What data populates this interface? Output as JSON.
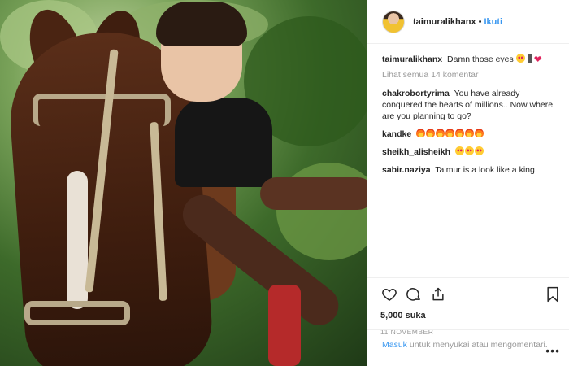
{
  "post": {
    "username": "taimuralikhanx",
    "separator": "•",
    "follow_label": "Ikuti"
  },
  "caption": {
    "username": "taimuralikhanx",
    "text": "Damn those eyes"
  },
  "view_all_comments": "Lihat semua 14 komentar",
  "comments": [
    {
      "username": "chakrobortyrima",
      "text": "You have already conquered the hearts of millions.. Now where are you planning to go?"
    },
    {
      "username": "kandke",
      "text": ""
    },
    {
      "username": "sheikh_alisheikh",
      "text": ""
    },
    {
      "username": "sabir.naziya",
      "text": "Taimur is a look like a king"
    }
  ],
  "likes": "5,000 suka",
  "date": "11 NOVEMBER",
  "login": {
    "link": "Masuk",
    "text": " untuk menyukai atau mengomentari."
  },
  "more_label": "•••",
  "icons": {
    "like": "heart-outline-icon",
    "comment": "comment-bubble-icon",
    "share": "share-upload-icon",
    "save": "bookmark-icon"
  },
  "colors": {
    "link": "#3897f0",
    "muted": "#999999",
    "text": "#262626"
  }
}
